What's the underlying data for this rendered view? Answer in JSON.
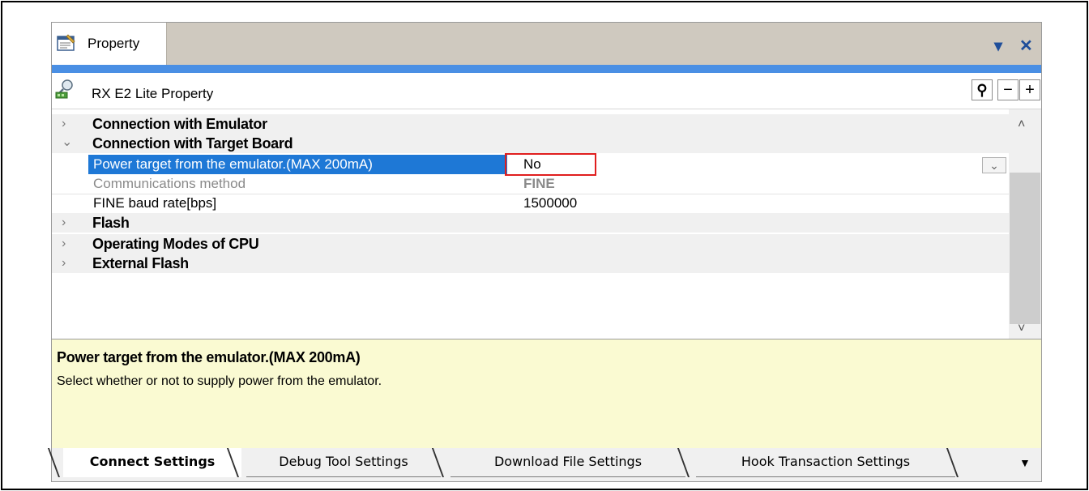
{
  "panel": {
    "tab_title": "Property",
    "pin_glyph": "▾",
    "close_glyph": "✕",
    "tab_icon": "property-icon"
  },
  "property_header": {
    "title": "RX E2 Lite Property",
    "icon": "debugger-probe-icon",
    "search_glyph": "⚲",
    "collapse_glyph": "−",
    "expand_glyph": "+"
  },
  "grid": {
    "categories_before": [
      {
        "label": "Connection with Emulator",
        "expanded": false
      }
    ],
    "expanded_category": {
      "label": "Connection with Target Board",
      "expanded": true
    },
    "properties": [
      {
        "name": "Power target from the emulator.(MAX 200mA)",
        "value": "No",
        "selected": true,
        "disabled": false
      },
      {
        "name": "Communications method",
        "value": "FINE",
        "selected": false,
        "disabled": true
      },
      {
        "name": "FINE baud rate[bps]",
        "value": "1500000",
        "selected": false,
        "disabled": false
      }
    ],
    "categories_after": [
      {
        "label": "Flash",
        "expanded": false
      },
      {
        "label": "Operating Modes of CPU",
        "expanded": false
      },
      {
        "label": "External Flash",
        "expanded": false
      }
    ],
    "chevron_collapsed": "›",
    "chevron_expanded": "⌄",
    "dropdown_glyph": "⌄"
  },
  "scrollbar": {
    "up_glyph": "˄",
    "down_glyph": "˅"
  },
  "description": {
    "title": "Power target from the emulator.(MAX 200mA)",
    "text": "Select whether or not to supply power from the emulator."
  },
  "bottom_tabs": {
    "items": [
      {
        "label": "Connect Settings",
        "active": true
      },
      {
        "label": "Debug Tool Settings",
        "active": false
      },
      {
        "label": "Download File Settings",
        "active": false
      },
      {
        "label": "Hook Transaction Settings",
        "active": false
      }
    ],
    "more_glyph": "▼"
  },
  "colors": {
    "accent_bar": "#4a8fe4",
    "selection": "#1e78d6",
    "highlight_border": "#e01e1e",
    "description_bg": "#fafad2"
  }
}
